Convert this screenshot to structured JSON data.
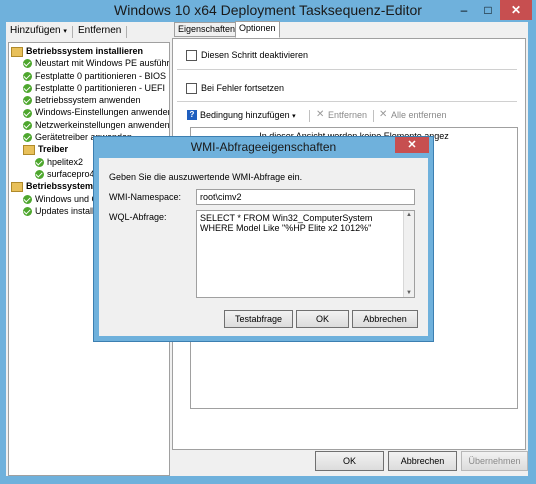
{
  "window": {
    "title": "Windows 10 x64 Deployment Tasksequenz-Editor",
    "minimize": "–",
    "maximize": "□",
    "close": "✕"
  },
  "toolbar": {
    "add_label": "Hinzufügen",
    "remove_label": "Entfernen"
  },
  "tree": {
    "items": [
      {
        "label": "Betriebssystem installieren",
        "kind": "group"
      },
      {
        "label": "Neustart mit Windows PE ausführen",
        "kind": "step"
      },
      {
        "label": "Festplatte 0 partitionieren - BIOS",
        "kind": "step"
      },
      {
        "label": "Festplatte 0 partitionieren - UEFI",
        "kind": "step"
      },
      {
        "label": "Betriebssystem anwenden",
        "kind": "step"
      },
      {
        "label": "Windows-Einstellungen anwenden",
        "kind": "step"
      },
      {
        "label": "Netzwerkeinstellungen anwenden",
        "kind": "step"
      },
      {
        "label": "Gerätetreiber anwenden",
        "kind": "step"
      },
      {
        "label": "Treiber",
        "kind": "subgroup"
      },
      {
        "label": "hpelitex2",
        "kind": "substep"
      },
      {
        "label": "surfacepro4",
        "kind": "substep"
      },
      {
        "label": "Betriebssystem e",
        "kind": "group"
      },
      {
        "label": "Windows und Con",
        "kind": "step"
      },
      {
        "label": "Updates installie",
        "kind": "step"
      }
    ]
  },
  "tabs": {
    "properties": "Eigenschaften",
    "options": "Optionen"
  },
  "options": {
    "disable_step": "Diesen Schritt deaktivieren",
    "continue_on_error": "Bei Fehler fortsetzen",
    "add_condition": "Bedingung hinzufügen",
    "remove": "Entfernen",
    "remove_all": "Alle entfernen",
    "list_hint": "In dieser Ansicht werden keine Elemente angez"
  },
  "footer": {
    "ok": "OK",
    "cancel": "Abbrechen",
    "apply": "Übernehmen"
  },
  "dialog": {
    "title": "WMI-Abfrageeigenschaften",
    "close": "✕",
    "instruction": "Geben Sie die auszuwertende WMI-Abfrage ein.",
    "namespace_label": "WMI-Namespace:",
    "namespace_value": "root\\cimv2",
    "query_label": "WQL-Abfrage:",
    "query_value": "SELECT * FROM Win32_ComputerSystem WHERE Model Like \"%HP Elite x2 1012%\"",
    "test_button": "Testabfrage",
    "ok_button": "OK",
    "cancel_button": "Abbrechen"
  }
}
